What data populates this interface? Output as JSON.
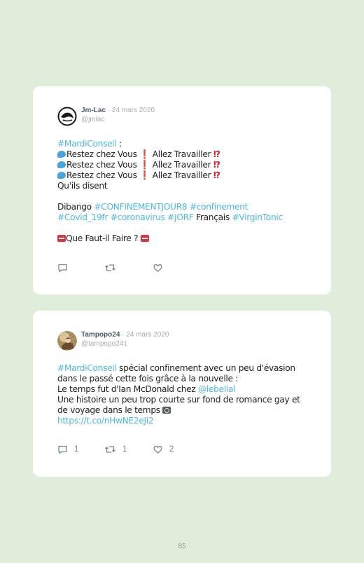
{
  "tweets": [
    {
      "author": "Jm-Lac",
      "date": "· 24 mars 2020",
      "handle": "@jmlac",
      "text": {
        "l1_tag": "#MardiConseil",
        "l1_rest": " :",
        "rep_a": "Restez chez Vous ",
        "excl": "❗",
        "rep_b": " Allez Travailler ",
        "qex": "⁉",
        "l5": "Qu'ils disent",
        "l7_plain": "Dibango ",
        "l7_tag1": "#CONFINEMENTJOUR8",
        "l7_tag2": "#confinement",
        "l8_tag1": "#Covid_19fr",
        "l8_tag2": "#coronavirus",
        "l8_tag3": "#JORF",
        "l8_plain": " Français ",
        "l8_tag4": "#VirginTonic",
        "l10": "Que Faut-il Faire ? "
      },
      "replies": "",
      "retweets": "",
      "likes": ""
    },
    {
      "author": "Tampopo24",
      "date": "· 24 mars 2020",
      "handle": "@tampopo241",
      "text": {
        "l1_tag": "#MardiConseil",
        "l1_rest": " spécial confinement avec un peu d'évasion",
        "l2": "dans le passé cette fois grâce à la nouvelle :",
        "l3_plain": "Le temps fut d'Ian McDonald chez ",
        "l3_mention": "@lebelial",
        "l4": "Une histoire un peu trop courte sur fond de romance gay et",
        "l5": "de voyage dans le temps ",
        "l6_link": "https://t.co/nHwNE2eJi2"
      },
      "replies": "1",
      "retweets": "1",
      "likes": "2"
    }
  ],
  "page_number": "85",
  "colors": {
    "background": "#e0edda",
    "card": "#ffffff",
    "hashtag": "#4eb7e6",
    "author": "#4b5b68",
    "muted": "#a5acb3",
    "icons": "#7a8792"
  },
  "icons": [
    "reply-icon",
    "retweet-icon",
    "like-icon",
    "speech-bubble-emoji",
    "exclamation-emoji",
    "interrobang-emoji",
    "stop-sign-emoji",
    "camera-emoji"
  ]
}
